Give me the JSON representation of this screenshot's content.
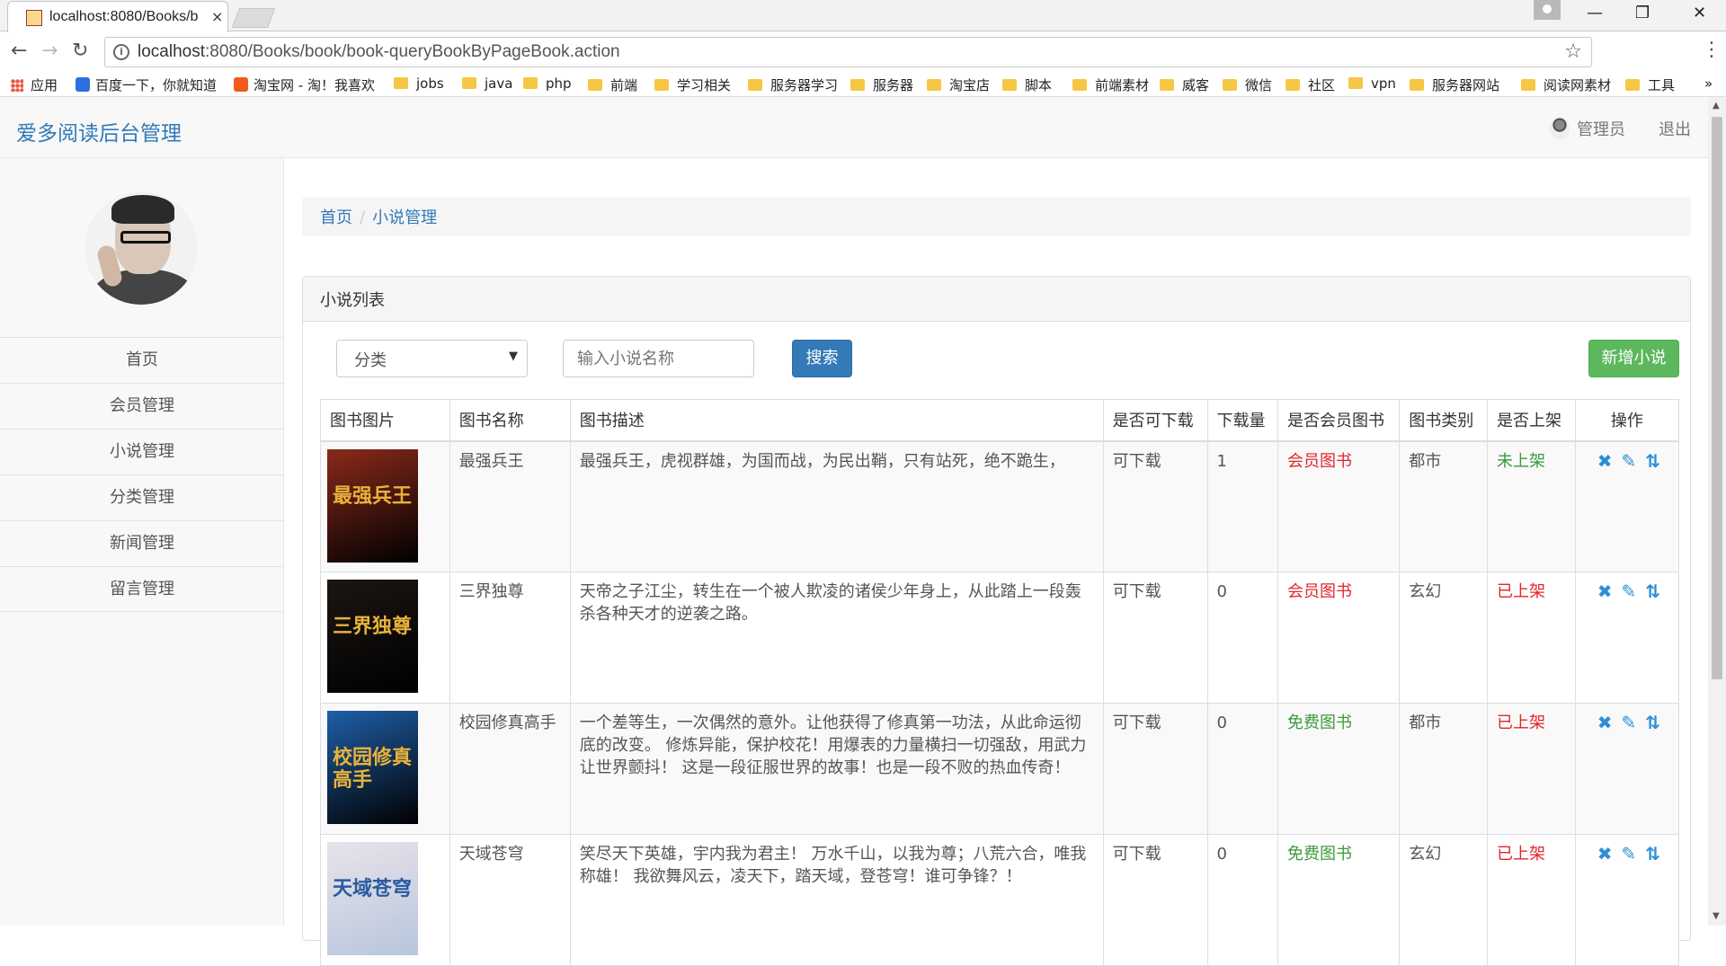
{
  "browser": {
    "tab_title": "localhost:8080/Books/b",
    "tab_close": "×",
    "url_host": "localhost",
    "url_path": ":8080/Books/book/book-queryBookByPageBook.action",
    "win_min": "—",
    "win_max": "❐",
    "win_close": "✕"
  },
  "bookmarks": [
    {
      "label": "应用",
      "kind": "apps"
    },
    {
      "label": "百度一下，你就知道",
      "kind": "baidu"
    },
    {
      "label": "淘宝网 - 淘！我喜欢",
      "kind": "taobao"
    },
    {
      "label": "jobs",
      "kind": "folder"
    },
    {
      "label": "java",
      "kind": "folder"
    },
    {
      "label": "php",
      "kind": "folder"
    },
    {
      "label": "前端",
      "kind": "folder"
    },
    {
      "label": "学习相关",
      "kind": "folder"
    },
    {
      "label": "服务器学习",
      "kind": "folder"
    },
    {
      "label": "服务器",
      "kind": "folder"
    },
    {
      "label": "淘宝店",
      "kind": "folder"
    },
    {
      "label": "脚本",
      "kind": "folder"
    },
    {
      "label": "前端素材",
      "kind": "folder"
    },
    {
      "label": "威客",
      "kind": "folder"
    },
    {
      "label": "微信",
      "kind": "folder"
    },
    {
      "label": "社区",
      "kind": "folder"
    },
    {
      "label": "vpn",
      "kind": "folder"
    },
    {
      "label": "服务器网站",
      "kind": "folder"
    },
    {
      "label": "阅读网素材",
      "kind": "folder"
    },
    {
      "label": "工具",
      "kind": "folder"
    }
  ],
  "bookmarks_more": "»",
  "app": {
    "brand": "爱多阅读后台管理",
    "admin": "管理员",
    "logout": "退出"
  },
  "sidebar": {
    "items": [
      {
        "label": "首页"
      },
      {
        "label": "会员管理"
      },
      {
        "label": "小说管理"
      },
      {
        "label": "分类管理"
      },
      {
        "label": "新闻管理"
      },
      {
        "label": "留言管理"
      }
    ]
  },
  "breadcrumb": {
    "home": "首页",
    "sep": "/",
    "current": "小说管理"
  },
  "panel": {
    "title": "小说列表"
  },
  "filters": {
    "category_select": "分类",
    "search_placeholder": "输入小说名称",
    "search_button": "搜索",
    "add_button": "新增小说"
  },
  "table": {
    "headers": [
      "图书图片",
      "图书名称",
      "图书描述",
      "是否可下载",
      "下载量",
      "是否会员图书",
      "图书类别",
      "是否上架",
      "操作"
    ],
    "rows": [
      {
        "name": "最强兵王",
        "desc": "最强兵王，虎视群雄，为国而战，为民出鞘，只有站死，绝不跪生，",
        "downloadable": "可下载",
        "downloads": "1",
        "member": "会员图书",
        "member_color": "#e0262b",
        "category": "都市",
        "shelf": "未上架",
        "shelf_color": "#3c9a3c",
        "cover_text": "最强兵王",
        "cover_color": "#8a2a1a"
      },
      {
        "name": "三界独尊",
        "desc": "天帝之子江尘，转生在一个被人欺凌的诸侯少年身上，从此踏上一段轰杀各种天才的逆袭之路。",
        "downloadable": "可下载",
        "downloads": "0",
        "member": "会员图书",
        "member_color": "#e0262b",
        "category": "玄幻",
        "shelf": "已上架",
        "shelf_color": "#e0262b",
        "cover_text": "三界独尊",
        "cover_color": "#1b1612"
      },
      {
        "name": "校园修真高手",
        "desc": "一个差等生，一次偶然的意外。让他获得了修真第一功法，从此命运彻底的改变。 修炼异能，保护校花！用爆表的力量横扫一切强敌，用武力让世界颤抖！ 这是一段征服世界的故事！也是一段不败的热血传奇！",
        "downloadable": "可下载",
        "downloads": "0",
        "member": "免费图书",
        "member_color": "#3c9a3c",
        "category": "都市",
        "shelf": "已上架",
        "shelf_color": "#e0262b",
        "cover_text": "校园修真高手",
        "cover_color": "#1f5fa8"
      },
      {
        "name": "天域苍穹",
        "desc": "笑尽天下英雄，宇内我为君主！ 万水千山，以我为尊；八荒六合，唯我称雄！ 我欲舞风云，凌天下，踏天域，登苍穹！谁可争锋？！",
        "downloadable": "可下载",
        "downloads": "0",
        "member": "免费图书",
        "member_color": "#3c9a3c",
        "category": "玄幻",
        "shelf": "已上架",
        "shelf_color": "#e0262b",
        "cover_text": "天域苍穹",
        "cover_color": "#e9e3ea"
      }
    ]
  },
  "icons": {
    "delete": "✖",
    "edit": "✎",
    "sort": "⇅"
  }
}
